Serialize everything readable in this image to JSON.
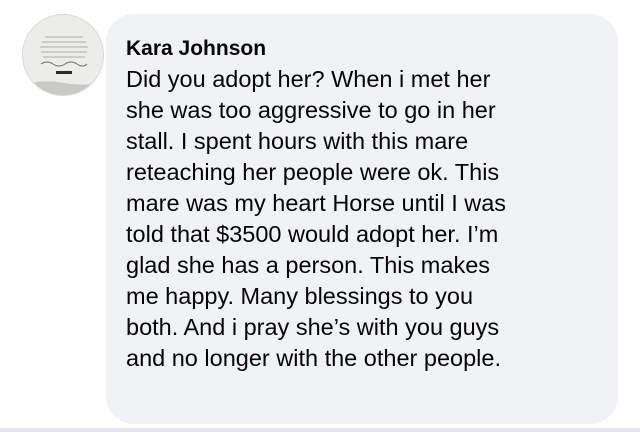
{
  "comment": {
    "author": "Kara Johnson",
    "lines": [
      "Did you adopt her? When i met her",
      "she was too aggressive to go in her",
      "stall. I spent hours with this mare",
      "reteaching her people were ok. This",
      "mare was my heart Horse until I was",
      "told that $3500 would adopt her. I’m",
      "glad she has a person. This makes",
      "me happy. Many blessings to you",
      "both. And i pray she’s with you guys",
      "and no longer with the other people."
    ],
    "avatar_icon": "profile-picture"
  },
  "colors": {
    "bubble_background": "#f0f2f5",
    "text": "#050505",
    "page_background": "#ffffff"
  }
}
